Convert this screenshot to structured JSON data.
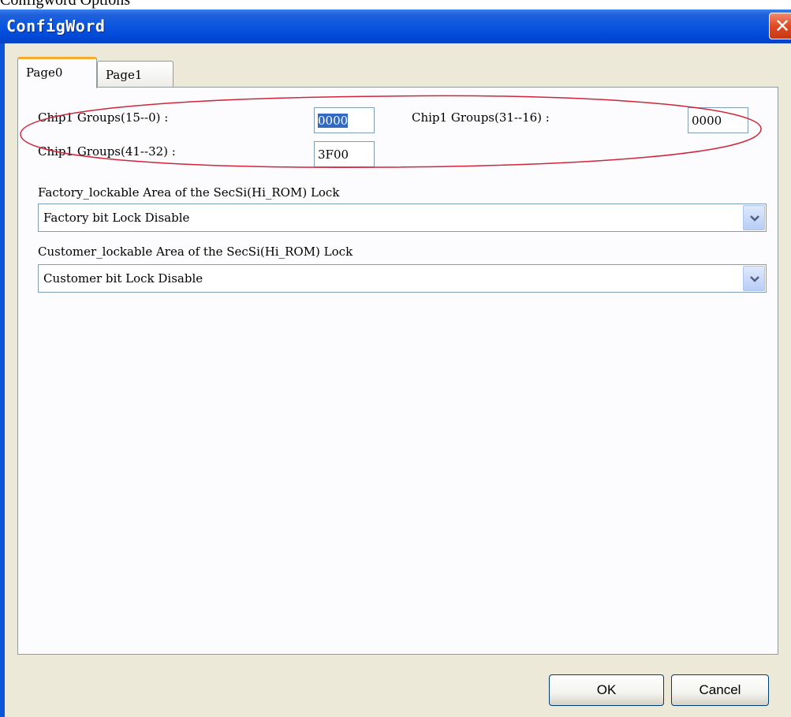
{
  "top_strip_text": "Configword Options",
  "window": {
    "title": "ConfigWord",
    "close_label": "✕"
  },
  "tabs": [
    {
      "label": "Page0"
    },
    {
      "label": "Page1"
    }
  ],
  "chip_groups": [
    {
      "label": "Chip1 Groups(15--0) :",
      "value": "0000"
    },
    {
      "label": "Chip1 Groups(31--16) :",
      "value": "0000"
    },
    {
      "label": "Chip1 Groups(41--32) :",
      "value": "3F00"
    }
  ],
  "factory": {
    "label": "Factory_lockable Area of the SecSi(Hi_ROM) Lock",
    "selected": "Factory bit Lock Disable"
  },
  "customer": {
    "label": "Customer_lockable Area of the SecSi(Hi_ROM) Lock",
    "selected": "Customer bit Lock Disable"
  },
  "buttons": {
    "ok": "OK",
    "cancel": "Cancel"
  },
  "colors": {
    "title_bar": "#0a55e0",
    "annotation_ellipse": "#d0253a",
    "selection": "#316ac5"
  },
  "icons": {
    "close": "close-icon",
    "dropdown": "chevron-down-icon"
  }
}
